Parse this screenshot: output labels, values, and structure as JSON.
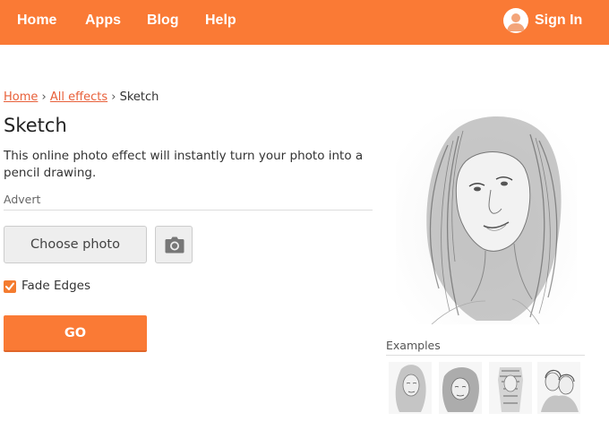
{
  "nav": {
    "home": "Home",
    "apps": "Apps",
    "blog": "Blog",
    "help": "Help",
    "sign_in": "Sign In"
  },
  "breadcrumb": {
    "home": "Home",
    "all_effects": "All effects",
    "separator": "›",
    "current": "Sketch"
  },
  "page": {
    "title": "Sketch",
    "description": "This online photo effect will instantly turn your photo into a pencil drawing.",
    "advert_label": "Advert"
  },
  "form": {
    "choose_photo_label": "Choose photo",
    "fade_edges_label": "Fade Edges",
    "fade_edges_checked": true,
    "go_label": "GO"
  },
  "examples": {
    "label": "Examples",
    "count_visible": 4
  },
  "colors": {
    "brand_orange": "#fa7a35",
    "link": "#e8603a",
    "checkbox": "#f47c30"
  }
}
